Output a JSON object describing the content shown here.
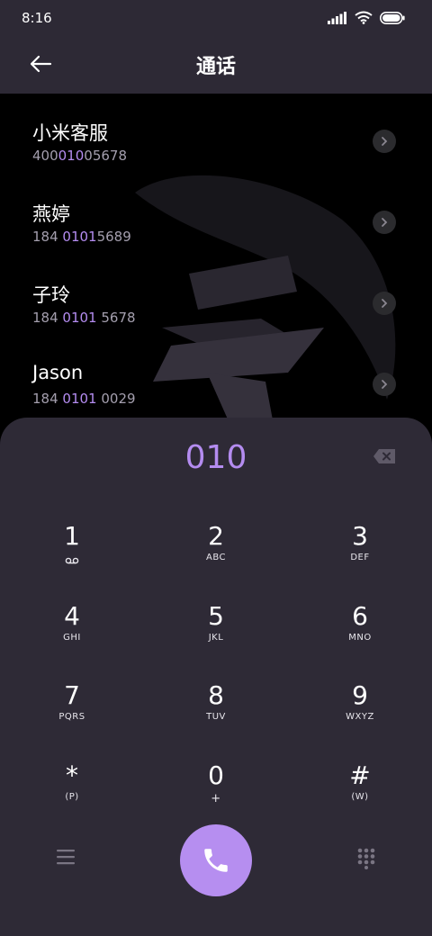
{
  "status": {
    "time": "8:16"
  },
  "header": {
    "title": "通话"
  },
  "contacts": [
    {
      "name": "小米客服",
      "num_pre": "400",
      "num_hl": "010",
      "num_post": "05678"
    },
    {
      "name": "燕婷",
      "num_pre": "184 ",
      "num_hl": "0101",
      "num_post": "5689"
    },
    {
      "name": "子玲",
      "num_pre": "184 ",
      "num_hl": "0101",
      "num_post": " 5678"
    },
    {
      "name": "Jason",
      "num_pre": "184 ",
      "num_hl": "0101",
      "num_post": " 0029"
    }
  ],
  "dialer": {
    "entry": "010",
    "keys": [
      {
        "digit": "1",
        "letters": ""
      },
      {
        "digit": "2",
        "letters": "ABC"
      },
      {
        "digit": "3",
        "letters": "DEF"
      },
      {
        "digit": "4",
        "letters": "GHI"
      },
      {
        "digit": "5",
        "letters": "JKL"
      },
      {
        "digit": "6",
        "letters": "MNO"
      },
      {
        "digit": "7",
        "letters": "PQRS"
      },
      {
        "digit": "8",
        "letters": "TUV"
      },
      {
        "digit": "9",
        "letters": "WXYZ"
      },
      {
        "digit": "*",
        "letters": "(P)"
      },
      {
        "digit": "0",
        "letters": "+"
      },
      {
        "digit": "#",
        "letters": "(W)"
      }
    ]
  },
  "icons": {
    "back": "arrow-left-icon",
    "backspace": "backspace-icon",
    "voicemail": "voicemail-icon",
    "menu": "menu-icon",
    "call": "phone-icon",
    "keypad": "keypad-icon"
  },
  "colors": {
    "accent": "#b48cf0",
    "panel": "#2e2a36",
    "call_button": "#b68ef0"
  }
}
